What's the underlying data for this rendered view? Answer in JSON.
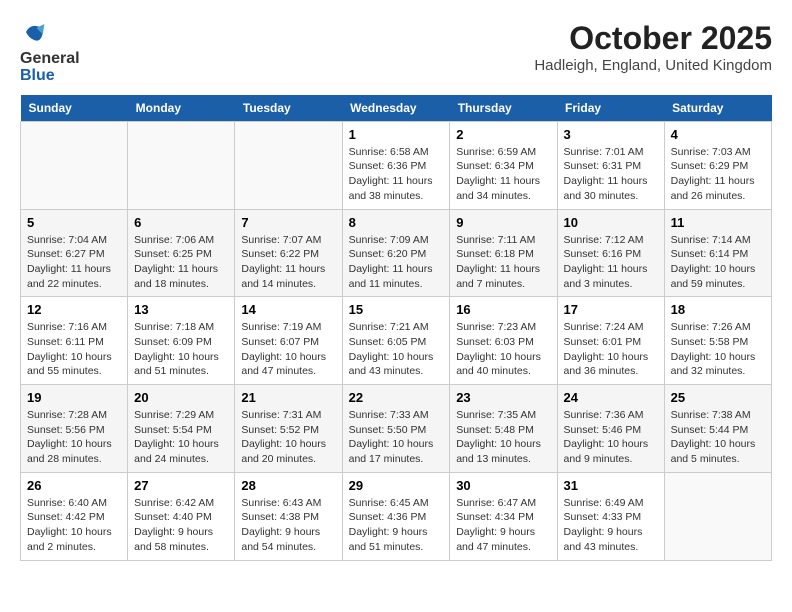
{
  "header": {
    "logo_line1": "General",
    "logo_line2": "Blue",
    "month_title": "October 2025",
    "location": "Hadleigh, England, United Kingdom"
  },
  "days_of_week": [
    "Sunday",
    "Monday",
    "Tuesday",
    "Wednesday",
    "Thursday",
    "Friday",
    "Saturday"
  ],
  "weeks": [
    [
      {
        "day": "",
        "info": ""
      },
      {
        "day": "",
        "info": ""
      },
      {
        "day": "",
        "info": ""
      },
      {
        "day": "1",
        "info": "Sunrise: 6:58 AM\nSunset: 6:36 PM\nDaylight: 11 hours\nand 38 minutes."
      },
      {
        "day": "2",
        "info": "Sunrise: 6:59 AM\nSunset: 6:34 PM\nDaylight: 11 hours\nand 34 minutes."
      },
      {
        "day": "3",
        "info": "Sunrise: 7:01 AM\nSunset: 6:31 PM\nDaylight: 11 hours\nand 30 minutes."
      },
      {
        "day": "4",
        "info": "Sunrise: 7:03 AM\nSunset: 6:29 PM\nDaylight: 11 hours\nand 26 minutes."
      }
    ],
    [
      {
        "day": "5",
        "info": "Sunrise: 7:04 AM\nSunset: 6:27 PM\nDaylight: 11 hours\nand 22 minutes."
      },
      {
        "day": "6",
        "info": "Sunrise: 7:06 AM\nSunset: 6:25 PM\nDaylight: 11 hours\nand 18 minutes."
      },
      {
        "day": "7",
        "info": "Sunrise: 7:07 AM\nSunset: 6:22 PM\nDaylight: 11 hours\nand 14 minutes."
      },
      {
        "day": "8",
        "info": "Sunrise: 7:09 AM\nSunset: 6:20 PM\nDaylight: 11 hours\nand 11 minutes."
      },
      {
        "day": "9",
        "info": "Sunrise: 7:11 AM\nSunset: 6:18 PM\nDaylight: 11 hours\nand 7 minutes."
      },
      {
        "day": "10",
        "info": "Sunrise: 7:12 AM\nSunset: 6:16 PM\nDaylight: 11 hours\nand 3 minutes."
      },
      {
        "day": "11",
        "info": "Sunrise: 7:14 AM\nSunset: 6:14 PM\nDaylight: 10 hours\nand 59 minutes."
      }
    ],
    [
      {
        "day": "12",
        "info": "Sunrise: 7:16 AM\nSunset: 6:11 PM\nDaylight: 10 hours\nand 55 minutes."
      },
      {
        "day": "13",
        "info": "Sunrise: 7:18 AM\nSunset: 6:09 PM\nDaylight: 10 hours\nand 51 minutes."
      },
      {
        "day": "14",
        "info": "Sunrise: 7:19 AM\nSunset: 6:07 PM\nDaylight: 10 hours\nand 47 minutes."
      },
      {
        "day": "15",
        "info": "Sunrise: 7:21 AM\nSunset: 6:05 PM\nDaylight: 10 hours\nand 43 minutes."
      },
      {
        "day": "16",
        "info": "Sunrise: 7:23 AM\nSunset: 6:03 PM\nDaylight: 10 hours\nand 40 minutes."
      },
      {
        "day": "17",
        "info": "Sunrise: 7:24 AM\nSunset: 6:01 PM\nDaylight: 10 hours\nand 36 minutes."
      },
      {
        "day": "18",
        "info": "Sunrise: 7:26 AM\nSunset: 5:58 PM\nDaylight: 10 hours\nand 32 minutes."
      }
    ],
    [
      {
        "day": "19",
        "info": "Sunrise: 7:28 AM\nSunset: 5:56 PM\nDaylight: 10 hours\nand 28 minutes."
      },
      {
        "day": "20",
        "info": "Sunrise: 7:29 AM\nSunset: 5:54 PM\nDaylight: 10 hours\nand 24 minutes."
      },
      {
        "day": "21",
        "info": "Sunrise: 7:31 AM\nSunset: 5:52 PM\nDaylight: 10 hours\nand 20 minutes."
      },
      {
        "day": "22",
        "info": "Sunrise: 7:33 AM\nSunset: 5:50 PM\nDaylight: 10 hours\nand 17 minutes."
      },
      {
        "day": "23",
        "info": "Sunrise: 7:35 AM\nSunset: 5:48 PM\nDaylight: 10 hours\nand 13 minutes."
      },
      {
        "day": "24",
        "info": "Sunrise: 7:36 AM\nSunset: 5:46 PM\nDaylight: 10 hours\nand 9 minutes."
      },
      {
        "day": "25",
        "info": "Sunrise: 7:38 AM\nSunset: 5:44 PM\nDaylight: 10 hours\nand 5 minutes."
      }
    ],
    [
      {
        "day": "26",
        "info": "Sunrise: 6:40 AM\nSunset: 4:42 PM\nDaylight: 10 hours\nand 2 minutes."
      },
      {
        "day": "27",
        "info": "Sunrise: 6:42 AM\nSunset: 4:40 PM\nDaylight: 9 hours\nand 58 minutes."
      },
      {
        "day": "28",
        "info": "Sunrise: 6:43 AM\nSunset: 4:38 PM\nDaylight: 9 hours\nand 54 minutes."
      },
      {
        "day": "29",
        "info": "Sunrise: 6:45 AM\nSunset: 4:36 PM\nDaylight: 9 hours\nand 51 minutes."
      },
      {
        "day": "30",
        "info": "Sunrise: 6:47 AM\nSunset: 4:34 PM\nDaylight: 9 hours\nand 47 minutes."
      },
      {
        "day": "31",
        "info": "Sunrise: 6:49 AM\nSunset: 4:33 PM\nDaylight: 9 hours\nand 43 minutes."
      },
      {
        "day": "",
        "info": ""
      }
    ]
  ]
}
